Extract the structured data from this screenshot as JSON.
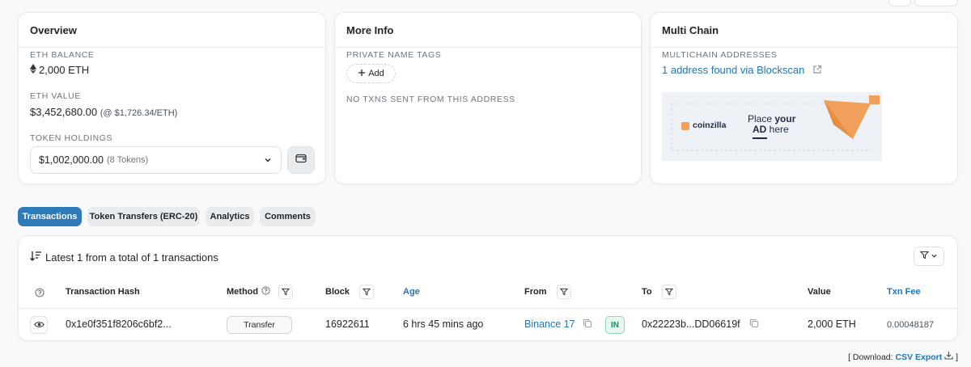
{
  "overview": {
    "title": "Overview",
    "eth_balance_label": "ETH BALANCE",
    "eth_balance_value": "2,000 ETH",
    "eth_value_label": "ETH VALUE",
    "eth_value_amount": "$3,452,680.00",
    "eth_value_rate": "(@ $1,726.34/ETH)",
    "token_holdings_label": "TOKEN HOLDINGS",
    "token_holdings_value": "$1,002,000.00",
    "token_holdings_count": "(8 Tokens)"
  },
  "more_info": {
    "title": "More Info",
    "private_tags_label": "PRIVATE NAME TAGS",
    "add_label": "Add",
    "no_txns_text": "NO TXNS SENT FROM THIS ADDRESS"
  },
  "multichain": {
    "title": "Multi Chain",
    "addresses_label": "MULTICHAIN ADDRESSES",
    "addresses_link": "1 address found via Blockscan",
    "ad": {
      "brand": "coinzilla",
      "line1_a": "Place ",
      "line1_b": "your",
      "line2_a": "AD",
      "line2_b": " here"
    }
  },
  "tabs": [
    {
      "label": "Transactions",
      "active": true
    },
    {
      "label": "Token Transfers (ERC-20)",
      "active": false
    },
    {
      "label": "Analytics",
      "active": false
    },
    {
      "label": "Comments",
      "active": false
    }
  ],
  "transactions": {
    "summary": "Latest 1 from a total of 1 transactions",
    "columns": {
      "hash": "Transaction Hash",
      "method": "Method",
      "block": "Block",
      "age": "Age",
      "from": "From",
      "to": "To",
      "value": "Value",
      "fee": "Txn Fee"
    },
    "rows": [
      {
        "hash": "0x1e0f351f8206c6bf2...",
        "method": "Transfer",
        "block": "16922611",
        "age": "6 hrs 45 mins ago",
        "from": "Binance 17",
        "direction": "IN",
        "to": "0x22223b...DD06619f",
        "value": "2,000 ETH",
        "fee": "0.00048187"
      }
    ]
  },
  "download": {
    "open": "[ Download: ",
    "link": "CSV Export",
    "close": " ]"
  },
  "colors": {
    "accent": "#2f7ab9",
    "link": "#1e74b8",
    "in_badge": "#0c8f5a",
    "ad_orange": "#f0a05a"
  }
}
